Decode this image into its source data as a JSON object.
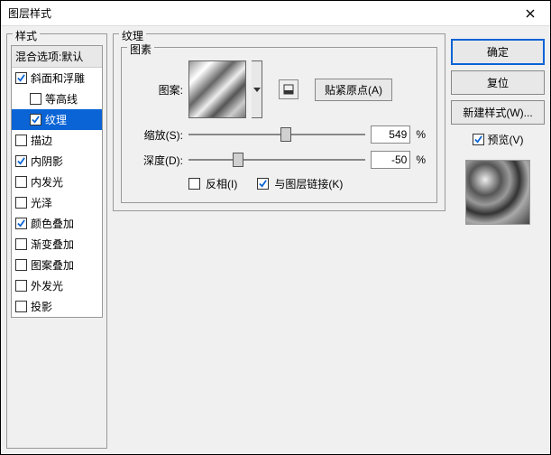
{
  "title": "图层样式",
  "leftGroupLabel": "样式",
  "styleList": {
    "header": "混合选项:默认",
    "items": [
      {
        "label": "斜面和浮雕",
        "checked": true,
        "indent": false,
        "selected": false
      },
      {
        "label": "等高线",
        "checked": false,
        "indent": true,
        "selected": false
      },
      {
        "label": "纹理",
        "checked": true,
        "indent": true,
        "selected": true
      },
      {
        "label": "描边",
        "checked": false,
        "indent": false,
        "selected": false
      },
      {
        "label": "内阴影",
        "checked": true,
        "indent": false,
        "selected": false
      },
      {
        "label": "内发光",
        "checked": false,
        "indent": false,
        "selected": false
      },
      {
        "label": "光泽",
        "checked": false,
        "indent": false,
        "selected": false
      },
      {
        "label": "颜色叠加",
        "checked": true,
        "indent": false,
        "selected": false
      },
      {
        "label": "渐变叠加",
        "checked": false,
        "indent": false,
        "selected": false
      },
      {
        "label": "图案叠加",
        "checked": false,
        "indent": false,
        "selected": false
      },
      {
        "label": "外发光",
        "checked": false,
        "indent": false,
        "selected": false
      },
      {
        "label": "投影",
        "checked": false,
        "indent": false,
        "selected": false
      }
    ]
  },
  "center": {
    "groupLabel": "纹理",
    "innerLabel": "图素",
    "patternLabel": "图案:",
    "snapBtn": "贴紧原点(A)",
    "scaleLabel": "缩放(S):",
    "scaleValue": "549",
    "scalePct": "%",
    "scalePos": 55,
    "depthLabel": "深度(D):",
    "depthValue": "-50",
    "depthPct": "%",
    "depthPos": 28,
    "invertLabel": "反相(I)",
    "invertChecked": false,
    "linkLabel": "与图层链接(K)",
    "linkChecked": true
  },
  "right": {
    "ok": "确定",
    "cancel": "复位",
    "newStyle": "新建样式(W)...",
    "previewLabel": "预览(V)",
    "previewChecked": true
  }
}
